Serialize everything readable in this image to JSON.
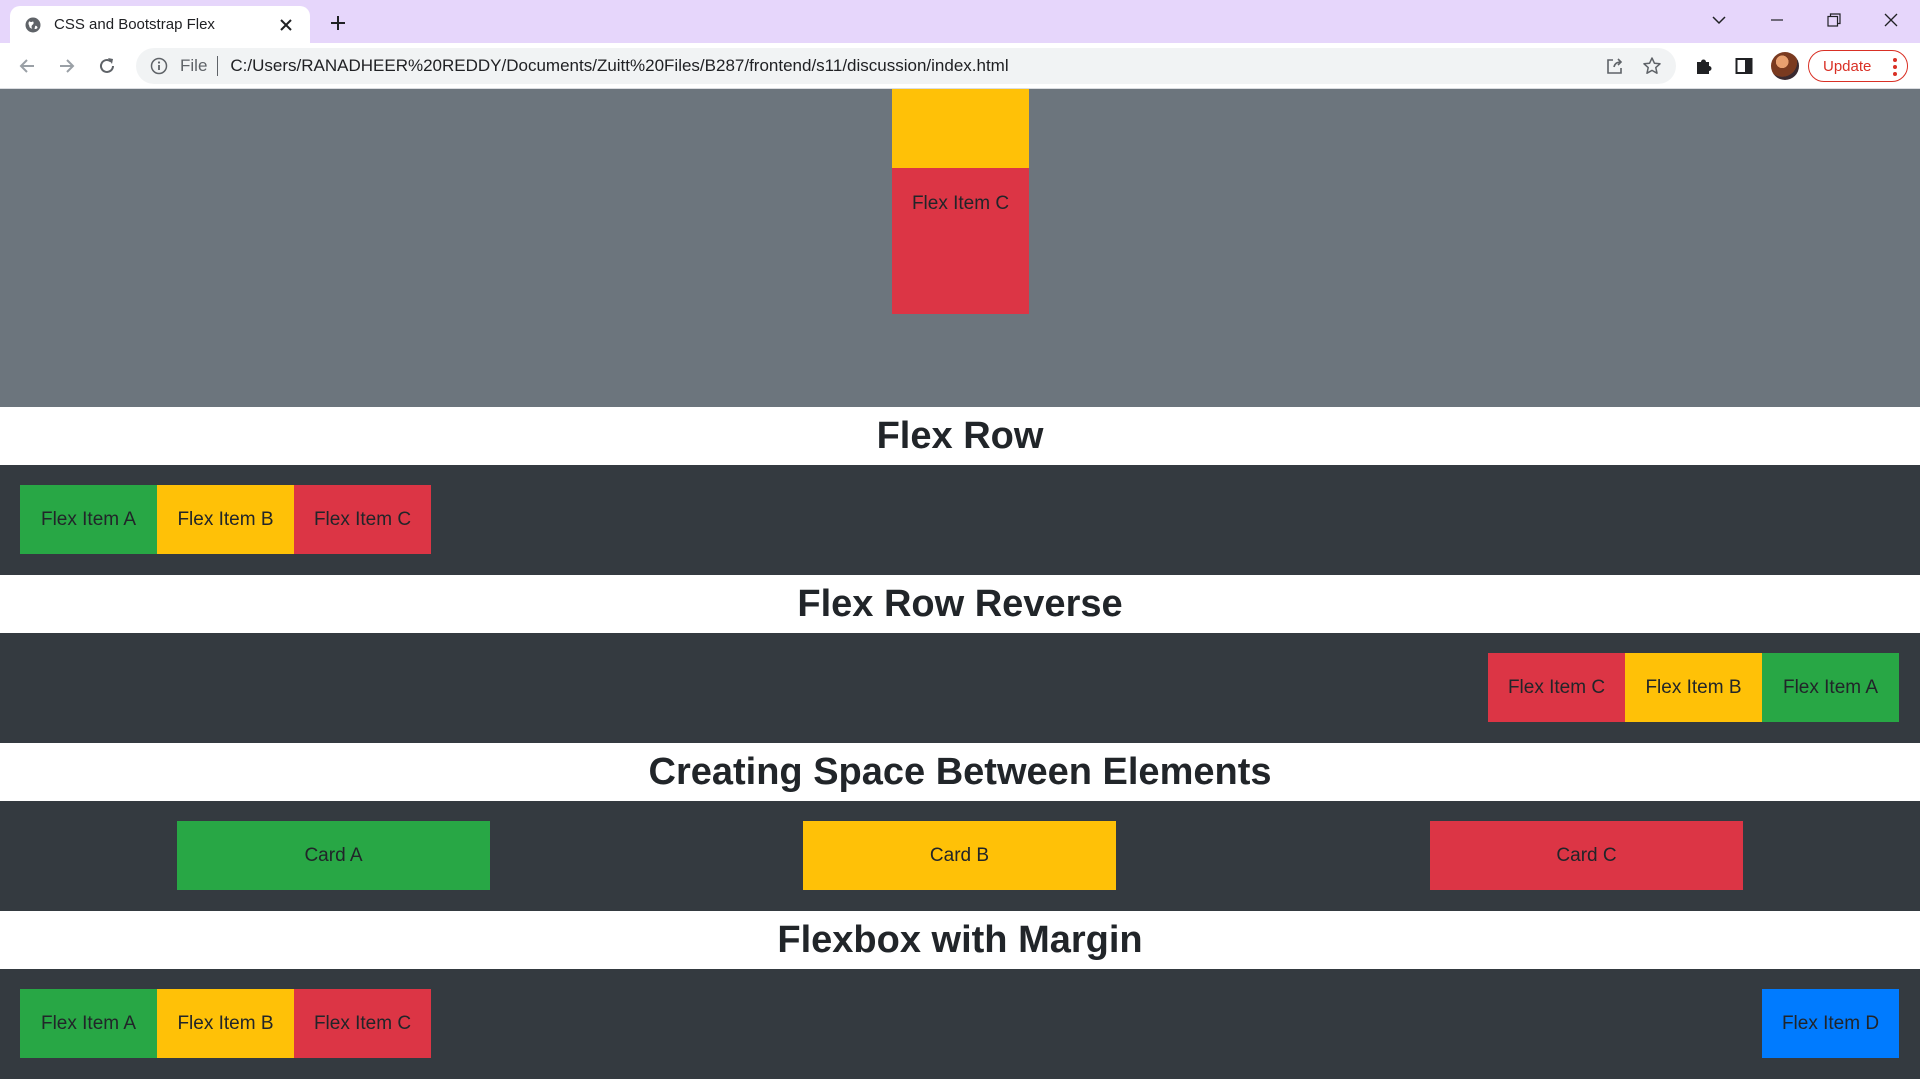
{
  "browser": {
    "tab_title": "CSS and Bootstrap Flex",
    "omnibox_scheme": "File",
    "url": "C:/Users/RANADHEER%20REDDY/Documents/Zuitt%20Files/B287/frontend/s11/discussion/index.html",
    "update_label": "Update"
  },
  "page": {
    "column_section": {
      "visible_item_label": "Flex Item C"
    },
    "sections": {
      "flex_row": {
        "heading": "Flex Row",
        "items": [
          "Flex Item A",
          "Flex Item B",
          "Flex Item C"
        ]
      },
      "flex_row_reverse": {
        "heading": "Flex Row Reverse",
        "items": [
          "Flex Item C",
          "Flex Item B",
          "Flex Item A"
        ]
      },
      "space_between": {
        "heading": "Creating Space Between Elements",
        "cards": [
          "Card A",
          "Card B",
          "Card C"
        ]
      },
      "margin": {
        "heading": "Flexbox with Margin",
        "items": [
          "Flex Item A",
          "Flex Item B",
          "Flex Item C",
          "Flex Item D"
        ]
      }
    }
  },
  "colors": {
    "tabbar": "#e6d6fb",
    "gray_section": "#6c757d",
    "dark_band": "#343a40",
    "success": "#28a745",
    "warning": "#ffc107",
    "danger": "#dc3545",
    "primary": "#007bff"
  },
  "icons": {
    "tab_favicon": "globe-icon",
    "back": "arrow-left-icon",
    "forward": "arrow-right-icon",
    "reload": "reload-icon",
    "site_info": "info-icon",
    "share": "share-icon",
    "bookmark": "star-icon",
    "extensions": "puzzle-icon",
    "side_panel": "side-panel-icon",
    "menu": "kebab-menu-icon"
  }
}
